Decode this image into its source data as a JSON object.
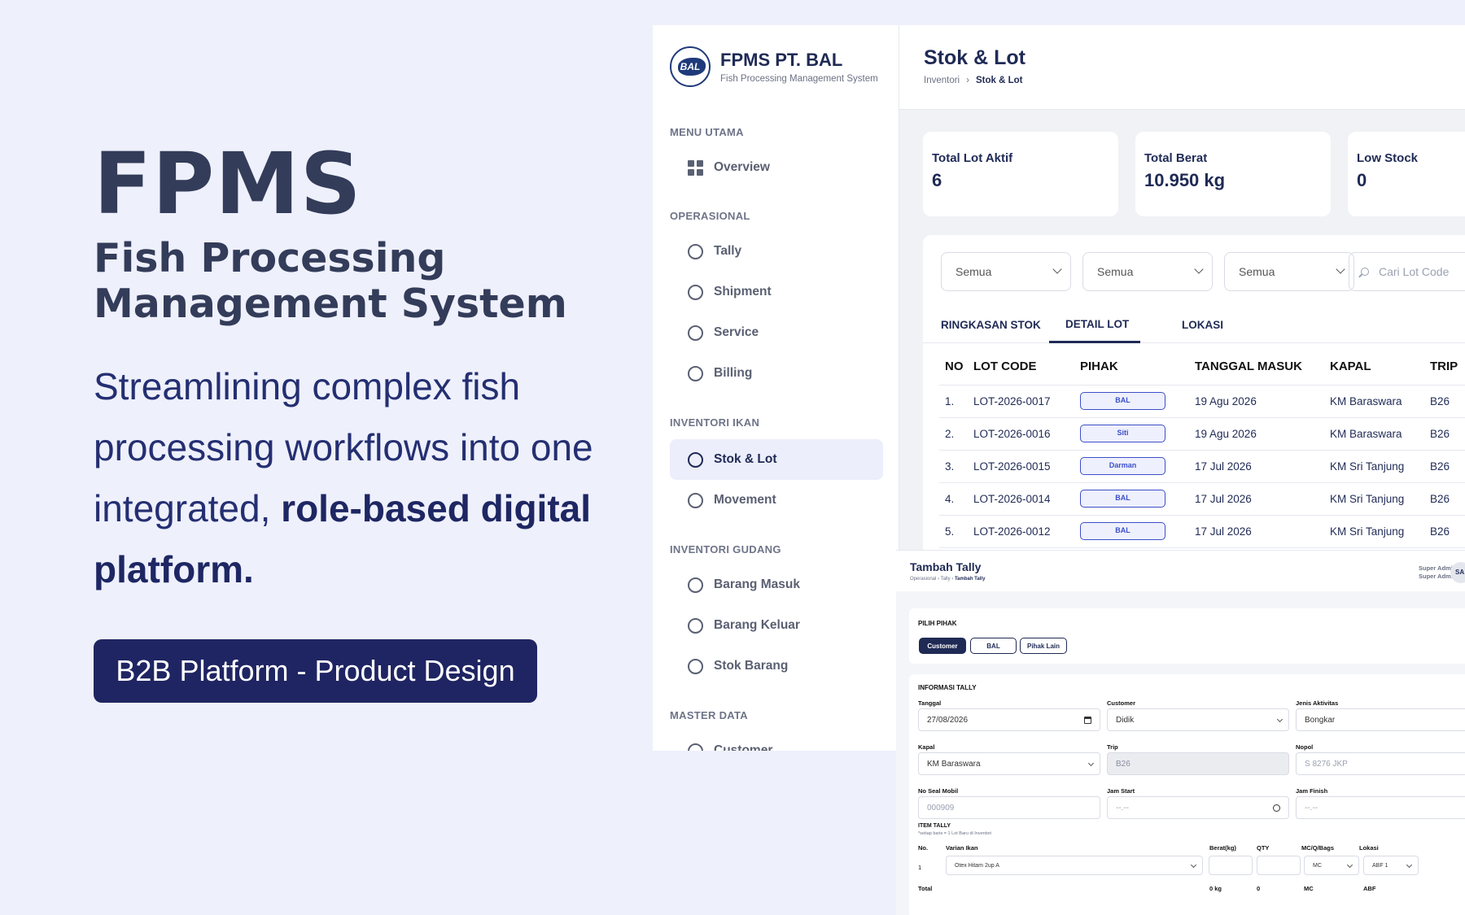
{
  "hero": {
    "title": "FPMS",
    "subtitle": "Fish Processing Management System",
    "desc_plain": "Streamlining complex fish processing workflows into one integrated, ",
    "desc_bold": "role-based digital platform.",
    "badge": "B2B Platform - Product Design"
  },
  "sidebar": {
    "brand_name": "FPMS PT. BAL",
    "brand_tagline": "Fish Processing Management System",
    "logo_text": "BAL",
    "sections": {
      "menu_utama": "MENU UTAMA",
      "operasional": "OPERASIONAL",
      "inventori_ikan": "INVENTORI IKAN",
      "inventori_gudang": "INVENTORI GUDANG",
      "master_data": "MASTER DATA"
    },
    "items": {
      "overview": "Overview",
      "tally": "Tally",
      "shipment": "Shipment",
      "service": "Service",
      "billing": "Billing",
      "stok_lot": "Stok & Lot",
      "movement": "Movement",
      "barang_masuk": "Barang Masuk",
      "barang_keluar": "Barang Keluar",
      "stok_barang": "Stok Barang",
      "customer": "Customer"
    }
  },
  "main": {
    "title": "Stok & Lot",
    "breadcrumb": {
      "parent": "Inventori",
      "sep": "›",
      "current": "Stok & Lot"
    },
    "stats": [
      {
        "label": "Total Lot Aktif",
        "value": "6"
      },
      {
        "label": "Total Berat",
        "value": "10.950 kg"
      },
      {
        "label": "Low Stock",
        "value": "0"
      }
    ],
    "filters": [
      "Semua",
      "Semua",
      "Semua"
    ],
    "search_placeholder": "Cari Lot Code",
    "tabs": [
      "RINGKASAN STOK",
      "DETAIL LOT",
      "LOKASI"
    ],
    "table": {
      "headers": [
        "NO",
        "LOT CODE",
        "PIHAK",
        "TANGGAL MASUK",
        "KAPAL",
        "TRIP"
      ],
      "rows": [
        [
          "1.",
          "LOT-2026-0017",
          "BAL",
          "19 Agu 2026",
          "KM Baraswara",
          "B26"
        ],
        [
          "2.",
          "LOT-2026-0016",
          "Siti",
          "19 Agu 2026",
          "KM Baraswara",
          "B26"
        ],
        [
          "3.",
          "LOT-2026-0015",
          "Darman",
          "17 Jul 2026",
          "KM Sri Tanjung",
          "B26"
        ],
        [
          "4.",
          "LOT-2026-0014",
          "BAL",
          "17 Jul 2026",
          "KM Sri Tanjung",
          "B26"
        ],
        [
          "5.",
          "LOT-2026-0012",
          "BAL",
          "17 Jul 2026",
          "KM Sri Tanjung",
          "B26"
        ]
      ]
    }
  },
  "tally": {
    "title": "Tambah Tally",
    "breadcrumb": {
      "a": "Operasional",
      "b": "Tally",
      "c": "Tambah Tally",
      "sep": "›"
    },
    "role_line1": "Super Admin",
    "role_line2": "Super Admin",
    "avatar": "SA",
    "pilih_pihak": "PILIH PIHAK",
    "pihak_options": [
      "Customer",
      "BAL",
      "Pihak Lain"
    ],
    "info_title": "INFORMASI TALLY",
    "fields": {
      "tanggal_label": "Tanggal",
      "tanggal_value": "27/08/2026",
      "customer_label": "Customer",
      "customer_value": "Didik",
      "jenis_label": "Jenis Aktivitas",
      "jenis_value": "Bongkar",
      "kapal_label": "Kapal",
      "kapal_value": "KM Baraswara",
      "trip_label": "Trip",
      "trip_value": "B26",
      "nopol_label": "Nopol",
      "nopol_placeholder": "S 8276 JKP",
      "seal_label": "No Seal Mobil",
      "seal_placeholder": "000909",
      "start_label": "Jam Start",
      "start_placeholder": "--.--",
      "finish_label": "Jam Finish",
      "finish_placeholder": "--.--"
    },
    "item_title": "ITEM TALLY",
    "item_note": "*setiap baris = 1 Lot Baru di Inventori",
    "item_headers": [
      "No.",
      "Varian Ikan",
      "Berat(kg)",
      "QTY",
      "MC/Q/Bags",
      "Lokasi"
    ],
    "item_row": {
      "no": "1",
      "varian": "Otex Hitam 2up A",
      "unit": "MC",
      "lokasi": "ABF 1"
    },
    "total_row": {
      "label": "Total",
      "berat": "0 kg",
      "qty": "0",
      "unit": "MC",
      "lokasi": "ABF"
    }
  }
}
